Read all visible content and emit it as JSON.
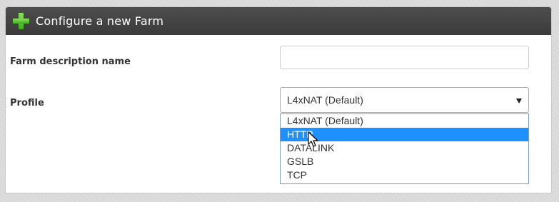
{
  "panel": {
    "title": "Configure a new Farm",
    "icon": "plus-icon"
  },
  "form": {
    "farm_name": {
      "label": "Farm description name",
      "value": "",
      "placeholder": ""
    },
    "profile": {
      "label": "Profile",
      "selected": "L4xNAT (Default)",
      "options": [
        "L4xNAT (Default)",
        "HTTP",
        "DATALINK",
        "GSLB",
        "TCP"
      ],
      "highlighted_option": "HTTP"
    }
  },
  "colors": {
    "header_bg": "#444444",
    "plus_green": "#5cc734",
    "highlight_blue": "#1e90ff"
  }
}
